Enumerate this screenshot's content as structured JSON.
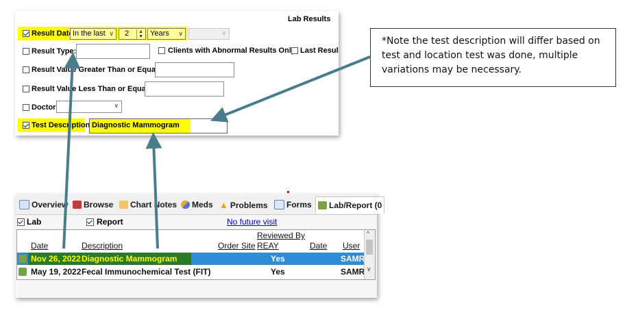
{
  "filter_panel": {
    "title": "Lab Results",
    "result_date": {
      "label": "Result Date",
      "checked": true,
      "mode": "In the last",
      "count": "2",
      "unit": "Years"
    },
    "result_type": {
      "label": "Result Type:",
      "checked": false,
      "value": ""
    },
    "abnormal_only": {
      "label": "Clients with Abnormal Results Only",
      "checked": false
    },
    "last_result": {
      "label": "Last Result O",
      "checked": false
    },
    "value_gte": {
      "label": "Result Value Greater Than or Equal to:",
      "checked": false,
      "value": ""
    },
    "value_lte": {
      "label": "Result Value Less Than or Equal to:",
      "checked": false,
      "value": ""
    },
    "doctor": {
      "label": "Doctor:",
      "checked": false,
      "value": ""
    },
    "test_description": {
      "label": "Test Description:",
      "checked": true,
      "value": "Diagnostic Mammogram"
    }
  },
  "note": {
    "text": "*Note the test description will differ based on test and location test was done, multiple variations may be necessary."
  },
  "lab_panel": {
    "tabs": [
      {
        "label": "Overview",
        "icon": "overview-icon"
      },
      {
        "label": "Browse",
        "icon": "book-icon"
      },
      {
        "label": "Chart Notes",
        "icon": "folder-icon"
      },
      {
        "label": "Meds",
        "icon": "pill-icon"
      },
      {
        "label": "Problems",
        "icon": "warning-icon"
      },
      {
        "label": "Forms",
        "icon": "form-icon"
      },
      {
        "label": "Lab/Report (0",
        "icon": "lab-icon"
      }
    ],
    "lab_checkbox": {
      "label": "Lab",
      "checked": true
    },
    "report_checkbox": {
      "label": "Report",
      "checked": true
    },
    "future_visit_link": "No future visit",
    "columns": {
      "date": "Date",
      "description": "Description",
      "order_site": "Order Site",
      "reviewed_by_top": "Reviewed By",
      "reviewed_by_bottom": "REAY",
      "reviewed_date": "Date",
      "user": "User"
    },
    "rows": [
      {
        "date": "Nov 26, 2022",
        "description": "Diagnostic Mammogram",
        "order_site": "",
        "reviewed": "Yes",
        "reviewed_date": "",
        "user": "SAMR",
        "selected": true
      },
      {
        "date": "May 19, 2022",
        "description": "Fecal Immunochemical Test (FIT)",
        "order_site": "",
        "reviewed": "Yes",
        "reviewed_date": "",
        "user": "SAMR",
        "selected": false
      }
    ]
  },
  "colors": {
    "highlight": "#ffff00",
    "arrow": "#4a7d8c",
    "selected_row": "#2e8bd6",
    "selected_green": "#2b7a2b",
    "link": "#0000cc"
  }
}
